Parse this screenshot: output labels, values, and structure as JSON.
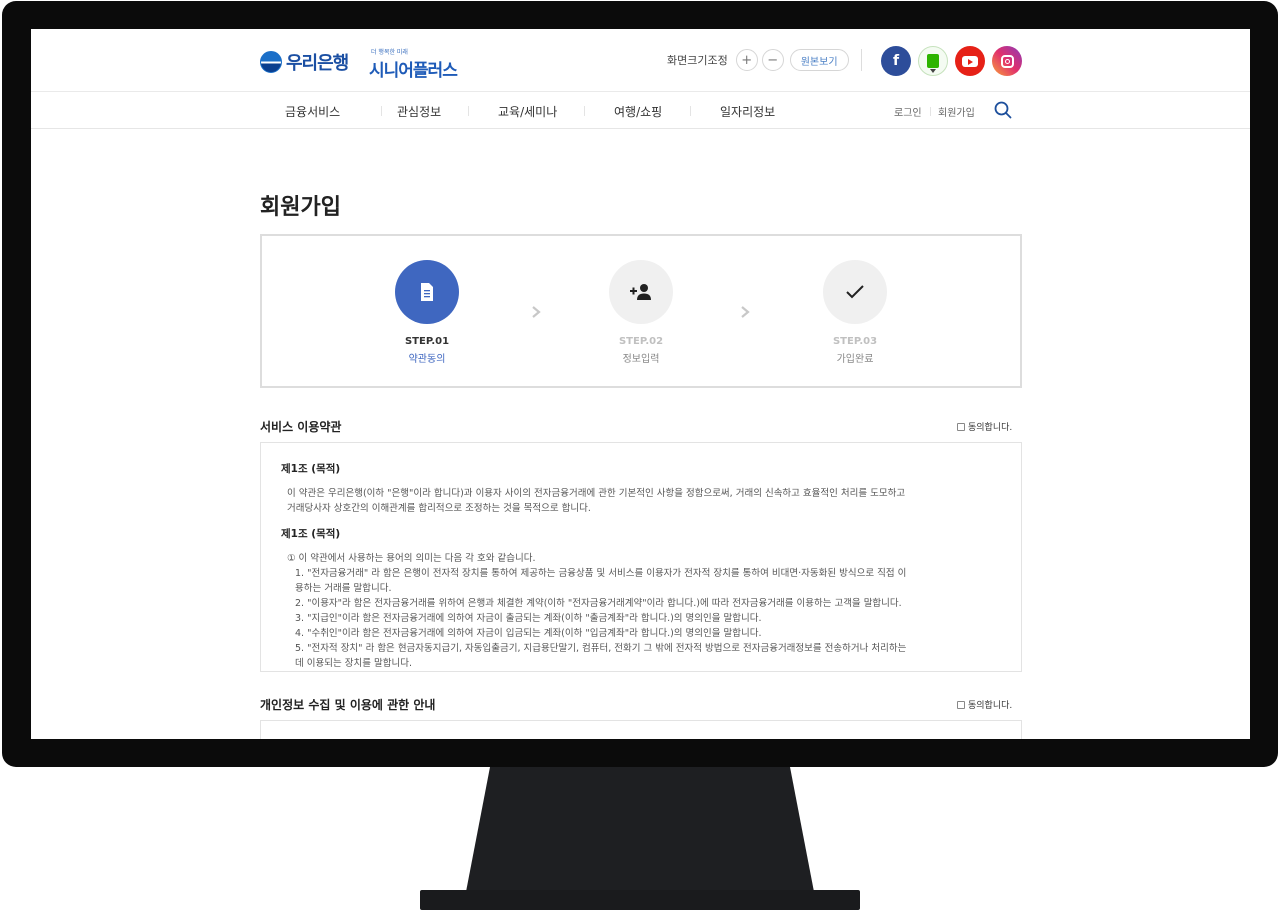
{
  "header": {
    "logo_text": "우리은행",
    "sub_logo_small": "더 행복한 미래",
    "sub_logo_main": "시니어플러스",
    "zoom_label": "화면크기조정",
    "zoom_in": "+",
    "zoom_out": "−",
    "zoom_reset": "원본보기",
    "social": [
      {
        "name": "facebook-icon",
        "glyph": "f",
        "color": "#2d4d9a"
      },
      {
        "name": "blog-icon",
        "glyph": "",
        "color": "#2db400"
      },
      {
        "name": "youtube-icon",
        "glyph": "",
        "color": "#e62117"
      },
      {
        "name": "instagram-icon",
        "glyph": "",
        "color": "#c13584"
      }
    ]
  },
  "nav": {
    "items": [
      "금융서비스",
      "관심정보",
      "교육/세미나",
      "여행/쇼핑",
      "일자리정보"
    ],
    "login": "로그인",
    "signup": "회원가입"
  },
  "page": {
    "title": "회원가입"
  },
  "steps": [
    {
      "num": "STEP.01",
      "name": "약관동의",
      "active": true,
      "icon": "document-icon"
    },
    {
      "num": "STEP.02",
      "name": "정보입력",
      "active": false,
      "icon": "add-user-icon"
    },
    {
      "num": "STEP.03",
      "name": "가입완료",
      "active": false,
      "icon": "check-icon"
    }
  ],
  "terms_section": {
    "title": "서비스 이용약관",
    "agree_label": "동의합니다.",
    "article1_title": "제1조 (목적)",
    "article1_body_1": "이 약관은 우리은행(이하 \"은행\"이라 합니다)과 이용자 사이의 전자금융거래에 관한 기본적인 사항을 정함으로써, 거래의 신속하고 효율적인 처리를 도모하고",
    "article1_body_2": "거래당사자 상호간의 이해관계를 합리적으로 조정하는 것을 목적으로 합니다.",
    "article2_title": "제1조 (목적)",
    "article2_lines": [
      "① 이 약관에서 사용하는 용어의 의미는 다음 각 호와 같습니다.",
      "1. \"전자금융거래\" 라 함은 은행이 전자적 장치를 통하여 제공하는 금융상품 및 서비스를 이용자가 전자적 장치를 통하여 비대면·자동화된 방식으로 직접 이",
      "용하는 거래를 말합니다.",
      "2. \"이용자\"라 함은 전자금융거래를 위하여 은행과 체결한 계약(이하 \"전자금융거래계약\"이라 합니다.)에 따라 전자금융거래를 이용하는 고객을 말합니다.",
      "3. \"지급인\"이라 함은 전자금융거래에 의하여 자금이 출금되는 계좌(이하 \"출금계좌\"라 합니다.)의 명의인을 말합니다.",
      "4. \"수취인\"이라 함은 전자금융거래에 의하여 자금이 입금되는 계좌(이하 \"입금계좌\"라 합니다.)의 명의인을 말합니다.",
      "5. \"전자적 장치\" 라 함은 현금자동지급기, 자동입출금기, 지급용단말기, 컴퓨터, 전화기 그 밖에 전자적 방법으로 전자금융거래정보를 전송하거나 처리하는",
      "데 이용되는 장치를 말합니다."
    ]
  },
  "privacy_section": {
    "title": "개인정보 수집 및 이용에 관한 안내",
    "agree_label": "동의합니다."
  }
}
